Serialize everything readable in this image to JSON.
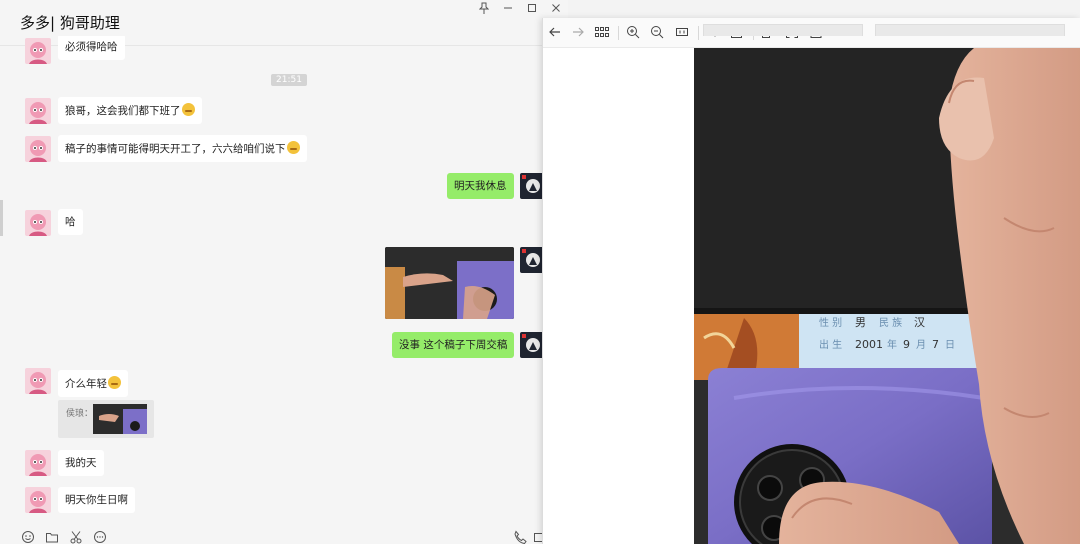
{
  "chat": {
    "title": "多多| 狗哥助理",
    "timestamp": "21:51",
    "messages": [
      {
        "side": "in",
        "text": "必须得哈哈"
      },
      {
        "side": "in",
        "text": "狼哥，这会我们都下班了"
      },
      {
        "side": "in",
        "text": "稿子的事情可能得明天开工了，六六给咱们说下"
      },
      {
        "side": "out",
        "text": "明天我休息"
      },
      {
        "side": "in",
        "text": "哈"
      },
      {
        "side": "out",
        "text": "没事 这个稿子下周交稿"
      },
      {
        "side": "in",
        "text": "介么年轻"
      },
      {
        "side": "in",
        "text": "我的天"
      },
      {
        "side": "in",
        "text": "明天你生日啊"
      }
    ],
    "quote_label": "侯琅："
  },
  "viewer": {
    "card_text": {
      "label_gender": "性 别",
      "gender": "男",
      "label_ethnicity": "民 族",
      "ethnicity": "汉",
      "label_birth": "出 生",
      "birth_year": "2001",
      "year_unit": "年",
      "birth_month": "9",
      "month_unit": "月",
      "birth_day": "7",
      "day_unit": "日"
    }
  },
  "colors": {
    "out_bubble": "#95ec69",
    "in_bubble": "#ffffff",
    "chat_bg": "#f5f5f5",
    "phone_purple": "#7e72c8"
  },
  "icons": {
    "window": [
      "pin-icon",
      "minimize-icon",
      "maximize-icon",
      "close-icon"
    ],
    "footer": [
      "emoji-icon",
      "folder-icon",
      "scissors-icon",
      "chat-bubble-icon",
      "phone-icon",
      "video-icon"
    ],
    "viewer_toolbar": [
      "back-arrow-icon",
      "forward-arrow-icon",
      "grid-icon",
      "zoom-in-icon",
      "zoom-out-icon",
      "actual-size-icon",
      "rotate-icon",
      "edit-icon",
      "copy-icon",
      "scan-icon",
      "download-icon"
    ]
  }
}
